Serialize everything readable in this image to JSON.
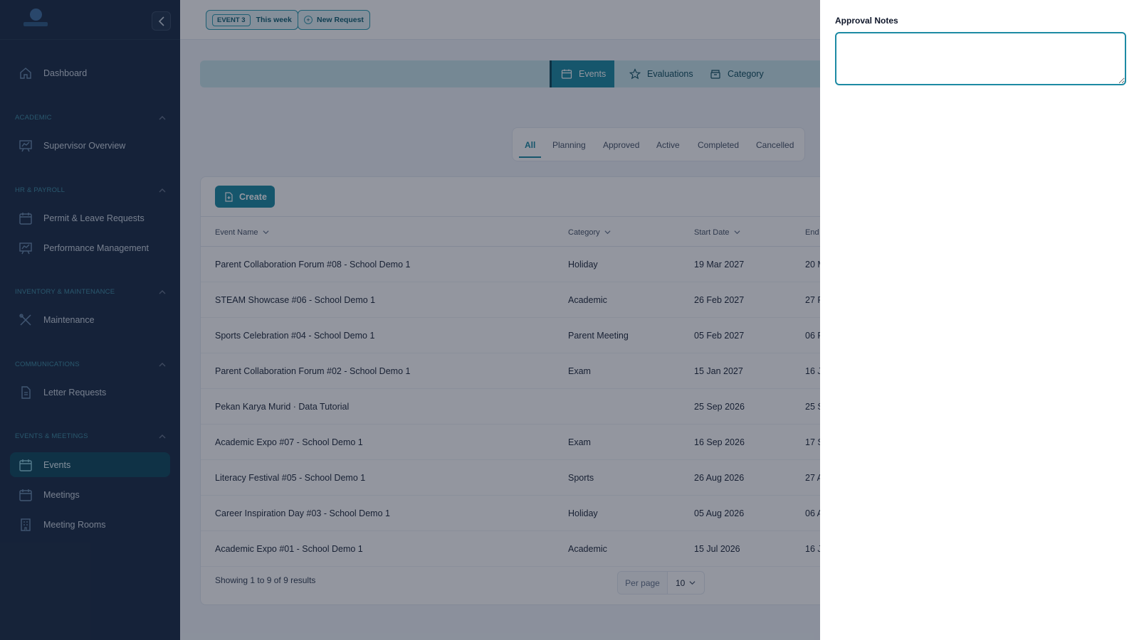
{
  "sidebar": {
    "nav": {
      "dashboard": "Dashboard",
      "supervisor": "Supervisor Overview",
      "permit": "Permit & Leave Requests",
      "performance": "Performance Management",
      "maintenance": "Maintenance",
      "letters": "Letter Requests",
      "events": "Events",
      "meetings": "Meetings",
      "rooms": "Meeting Rooms"
    },
    "sections": {
      "academic": "ACADEMIC",
      "hr": "HR & PAYROLL",
      "inventory": "INVENTORY & MAINTENANCE",
      "communications": "COMMUNICATIONS",
      "events": "EVENTS & MEETINGS"
    },
    "active_item": "Events"
  },
  "topbar": {
    "event_badge": "EVENT 3",
    "this_week": "This week",
    "new_request": "New Request"
  },
  "module_tabs": {
    "events": "Events",
    "evaluations": "Evaluations",
    "category": "Category"
  },
  "status_tabs": {
    "all": "All",
    "planning": "Planning",
    "approved": "Approved",
    "active": "Active",
    "completed": "Completed",
    "cancelled": "Cancelled",
    "selected": "All"
  },
  "table": {
    "create_label": "Create",
    "headers": {
      "name": "Event Name",
      "category": "Category",
      "start": "Start Date",
      "end": "End"
    },
    "rows": [
      {
        "name": "Parent Collaboration Forum #08 - School Demo 1",
        "category": "Holiday",
        "start": "19 Mar 2027",
        "end": "20 M"
      },
      {
        "name": "STEAM Showcase #06 - School Demo 1",
        "category": "Academic",
        "start": "26 Feb 2027",
        "end": "27 F"
      },
      {
        "name": "Sports Celebration #04 - School Demo 1",
        "category": "Parent Meeting",
        "start": "05 Feb 2027",
        "end": "06 F"
      },
      {
        "name": "Parent Collaboration Forum #02 - School Demo 1",
        "category": "Exam",
        "start": "15 Jan 2027",
        "end": "16 J"
      },
      {
        "name": "Pekan Karya Murid · Data Tutorial",
        "category": "",
        "start": "25 Sep 2026",
        "end": "25 S"
      },
      {
        "name": "Academic Expo #07 - School Demo 1",
        "category": "Exam",
        "start": "16 Sep 2026",
        "end": "17 S"
      },
      {
        "name": "Literacy Festival #05 - School Demo 1",
        "category": "Sports",
        "start": "26 Aug 2026",
        "end": "27 A"
      },
      {
        "name": "Career Inspiration Day #03 - School Demo 1",
        "category": "Holiday",
        "start": "05 Aug 2026",
        "end": "06 A"
      },
      {
        "name": "Academic Expo #01 - School Demo 1",
        "category": "Academic",
        "start": "15 Jul 2026",
        "end": "16 J"
      }
    ],
    "footer": {
      "showing": "Showing 1 to 9 of 9 results",
      "per_page_label": "Per page",
      "per_page_value": "10"
    }
  },
  "panel": {
    "label": "Approval Notes",
    "value": ""
  },
  "colors": {
    "sidebar_bg": "#1b2d45",
    "accent": "#1d8aa3",
    "overlay": "rgba(15,23,42,0.45)"
  }
}
